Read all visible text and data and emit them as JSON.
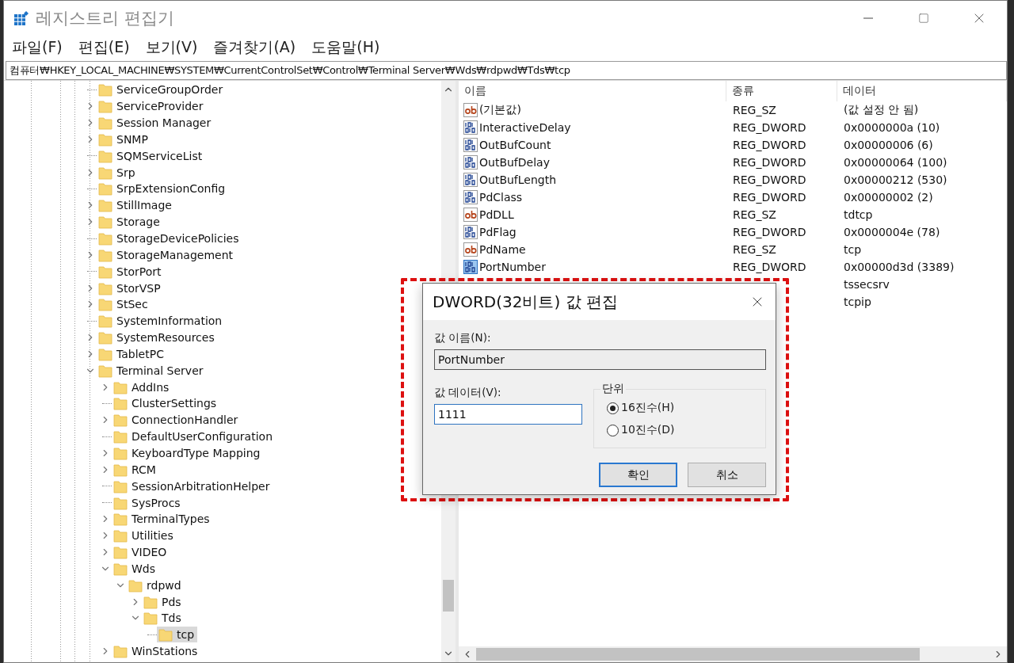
{
  "window": {
    "title": "레지스트리 편집기"
  },
  "menu": [
    "파일(F)",
    "편집(E)",
    "보기(V)",
    "즐겨찾기(A)",
    "도움말(H)"
  ],
  "address": "컴퓨터₩HKEY_LOCAL_MACHINE₩SYSTEM₩CurrentControlSet₩Control₩Terminal Server₩Wds₩rdpwd₩Tds₩tcp",
  "tree": [
    {
      "label": "ServiceGroupOrder",
      "selected": false
    },
    {
      "label": "ServiceProvider",
      "expanded": false,
      "selected": false
    },
    {
      "label": "Session Manager",
      "expanded": false,
      "selected": false
    },
    {
      "label": "SNMP",
      "expanded": false,
      "selected": false
    },
    {
      "label": "SQMServiceList",
      "selected": false
    },
    {
      "label": "Srp",
      "expanded": false,
      "selected": false
    },
    {
      "label": "SrpExtensionConfig",
      "selected": false
    },
    {
      "label": "StillImage",
      "expanded": false,
      "selected": false
    },
    {
      "label": "Storage",
      "expanded": false,
      "selected": false
    },
    {
      "label": "StorageDevicePolicies",
      "selected": false
    },
    {
      "label": "StorageManagement",
      "expanded": false,
      "selected": false
    },
    {
      "label": "StorPort",
      "selected": false
    },
    {
      "label": "StorVSP",
      "expanded": false,
      "selected": false
    },
    {
      "label": "StSec",
      "expanded": false,
      "selected": false
    },
    {
      "label": "SystemInformation",
      "selected": false
    },
    {
      "label": "SystemResources",
      "expanded": false,
      "selected": false
    },
    {
      "label": "TabletPC",
      "expanded": false,
      "selected": false
    },
    {
      "label": "Terminal Server",
      "expanded": true,
      "selected": false,
      "children": [
        {
          "label": "AddIns",
          "expanded": false,
          "selected": false
        },
        {
          "label": "ClusterSettings",
          "selected": false
        },
        {
          "label": "ConnectionHandler",
          "expanded": false,
          "selected": false
        },
        {
          "label": "DefaultUserConfiguration",
          "selected": false
        },
        {
          "label": "KeyboardType Mapping",
          "expanded": false,
          "selected": false
        },
        {
          "label": "RCM",
          "expanded": false,
          "selected": false
        },
        {
          "label": "SessionArbitrationHelper",
          "selected": false
        },
        {
          "label": "SysProcs",
          "selected": false
        },
        {
          "label": "TerminalTypes",
          "expanded": false,
          "selected": false
        },
        {
          "label": "Utilities",
          "expanded": false,
          "selected": false
        },
        {
          "label": "VIDEO",
          "expanded": false,
          "selected": false
        },
        {
          "label": "Wds",
          "expanded": true,
          "selected": false,
          "children": [
            {
              "label": "rdpwd",
              "expanded": true,
              "selected": false,
              "children": [
                {
                  "label": "Pds",
                  "expanded": false,
                  "selected": false
                },
                {
                  "label": "Tds",
                  "expanded": true,
                  "selected": false,
                  "children": [
                    {
                      "label": "tcp",
                      "selected": true
                    }
                  ]
                }
              ]
            }
          ]
        },
        {
          "label": "WinStations",
          "expanded": false,
          "selected": false
        }
      ]
    }
  ],
  "values": {
    "columns": [
      "이름",
      "종류",
      "데이터"
    ],
    "rows": [
      {
        "kind": "string",
        "name": "(기본값)",
        "type": "REG_SZ",
        "data": "(값 설정 안 됨)",
        "selected": false
      },
      {
        "kind": "dword",
        "name": "InteractiveDelay",
        "type": "REG_DWORD",
        "data": "0x0000000a (10)",
        "selected": false
      },
      {
        "kind": "dword",
        "name": "OutBufCount",
        "type": "REG_DWORD",
        "data": "0x00000006 (6)",
        "selected": false
      },
      {
        "kind": "dword",
        "name": "OutBufDelay",
        "type": "REG_DWORD",
        "data": "0x00000064 (100)",
        "selected": false
      },
      {
        "kind": "dword",
        "name": "OutBufLength",
        "type": "REG_DWORD",
        "data": "0x00000212 (530)",
        "selected": false
      },
      {
        "kind": "dword",
        "name": "PdClass",
        "type": "REG_DWORD",
        "data": "0x00000002 (2)",
        "selected": false
      },
      {
        "kind": "string",
        "name": "PdDLL",
        "type": "REG_SZ",
        "data": "tdtcp",
        "selected": false
      },
      {
        "kind": "dword",
        "name": "PdFlag",
        "type": "REG_DWORD",
        "data": "0x0000004e (78)",
        "selected": false
      },
      {
        "kind": "string",
        "name": "PdName",
        "type": "REG_SZ",
        "data": "tcp",
        "selected": false
      },
      {
        "kind": "dword",
        "name": "PortNumber",
        "type": "REG_DWORD",
        "data": "0x00000d3d (3389)",
        "selected": true
      },
      {
        "data": "tssecsrv"
      },
      {
        "data": "tcpip"
      }
    ]
  },
  "dialog": {
    "title": "DWORD(32비트) 값 편집",
    "name_label": "값 이름(N):",
    "name_value": "PortNumber",
    "data_label": "값 데이터(V):",
    "data_value": "1111",
    "base_label": "단위",
    "bases": [
      {
        "label": "16진수(H)",
        "selected": true
      },
      {
        "label": "10진수(D)",
        "selected": false
      }
    ],
    "buttons": [
      {
        "label": "확인",
        "default": true
      },
      {
        "label": "취소",
        "default": false
      }
    ]
  }
}
